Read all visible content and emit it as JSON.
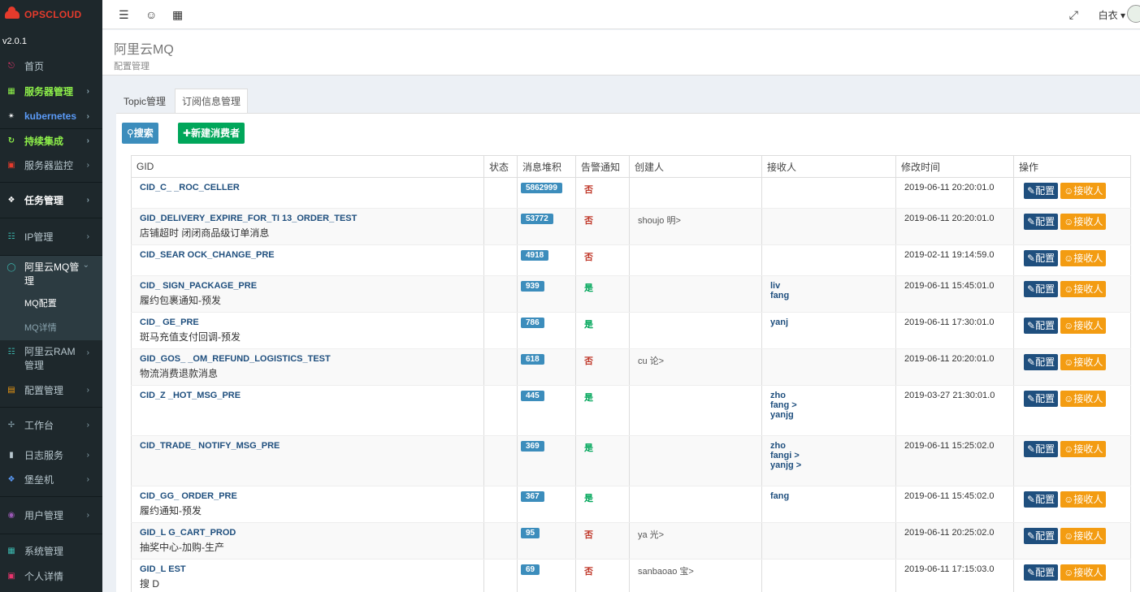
{
  "sidebar": {
    "logo": "OPSCLOUD",
    "version": "v2.0.1",
    "items": [
      {
        "label": "首页",
        "icon": "dashboard-icon"
      },
      {
        "label": "服务器管理",
        "icon": "windows-icon"
      },
      {
        "label": "kubernetes",
        "icon": "kubernetes-icon"
      },
      {
        "label": "持续集成",
        "icon": "ci-icon"
      },
      {
        "label": "服务器监控",
        "icon": "monitor-icon"
      },
      {
        "label": "任务管理",
        "icon": "task-icon"
      },
      {
        "label": "IP管理",
        "icon": "network-icon"
      },
      {
        "label": "阿里云MQ管理",
        "icon": "chat-icon"
      },
      {
        "label": "阿里云RAM管理",
        "icon": "ram-icon"
      },
      {
        "label": "配置管理",
        "icon": "config-icon"
      },
      {
        "label": "工作台",
        "icon": "workbench-icon"
      },
      {
        "label": "日志服务",
        "icon": "log-icon"
      },
      {
        "label": "堡垒机",
        "icon": "bastion-icon"
      },
      {
        "label": "用户管理",
        "icon": "user-icon"
      },
      {
        "label": "系统管理",
        "icon": "system-icon"
      },
      {
        "label": "个人详情",
        "icon": "profile-icon"
      }
    ],
    "sub": [
      "MQ配置",
      "MQ详情"
    ]
  },
  "topbar": {
    "user": "白衣"
  },
  "header": {
    "title": "阿里云MQ",
    "subtitle": "配置管理"
  },
  "tabs": [
    "Topic管理",
    "订阅信息管理"
  ],
  "buttons": {
    "search": "搜索",
    "new": "新建消费者"
  },
  "table": {
    "headers": [
      "GID",
      "状态",
      "消息堆积",
      "告警通知",
      "创建人",
      "接收人",
      "修改时间",
      "操作"
    ],
    "config_label": "配置",
    "recv_label": "接收人",
    "rows": [
      {
        "gid": "CID_C_ _ROC_CELLER",
        "desc": "",
        "stock": "5862999",
        "alarm": "否",
        "creator": "",
        "receivers": [],
        "time": "2019-06-11 20:20:01.0"
      },
      {
        "gid": "GID_DELIVERY_EXPIRE_FOR_TI 13_ORDER_TEST",
        "desc": "店铺超时 闭闭商品级订单消息",
        "stock": "53772",
        "alarm": "否",
        "creator": "shoujo 明>",
        "receivers": [],
        "time": "2019-06-11 20:20:01.0"
      },
      {
        "gid": "CID_SEAR OCK_CHANGE_PRE",
        "desc": "",
        "stock": "4918",
        "alarm": "否",
        "creator": "",
        "receivers": [],
        "time": "2019-02-11 19:14:59.0"
      },
      {
        "gid": "CID_ SIGN_PACKAGE_PRE",
        "desc": "履约包裹通知-预发",
        "stock": "939",
        "alarm": "是",
        "creator": "",
        "receivers": [
          "liv",
          "fang"
        ],
        "time": "2019-06-11 15:45:01.0"
      },
      {
        "gid": "CID_ GE_PRE",
        "desc": "斑马充值支付回调-预发",
        "stock": "786",
        "alarm": "是",
        "creator": "",
        "receivers": [
          "yanj"
        ],
        "time": "2019-06-11 17:30:01.0"
      },
      {
        "gid": "GID_GOS_ _OM_REFUND_LOGISTICS_TEST",
        "desc": "物流消费退款消息",
        "stock": "618",
        "alarm": "否",
        "creator": "cu 论>",
        "receivers": [],
        "time": "2019-06-11 20:20:01.0"
      },
      {
        "gid": "CID_Z _HOT_MSG_PRE",
        "desc": "",
        "stock": "445",
        "alarm": "是",
        "creator": "",
        "receivers": [
          "zho",
          "fang >",
          "yanjg"
        ],
        "time": "2019-03-27 21:30:01.0"
      },
      {
        "gid": "CID_TRADE_ NOTIFY_MSG_PRE",
        "desc": "",
        "stock": "369",
        "alarm": "是",
        "creator": "",
        "receivers": [
          "zho",
          "fangi >",
          "yanjg >"
        ],
        "time": "2019-06-11 15:25:02.0"
      },
      {
        "gid": "CID_GG_ ORDER_PRE",
        "desc": "履约通知-预发",
        "stock": "367",
        "alarm": "是",
        "creator": "",
        "receivers": [
          "fang"
        ],
        "time": "2019-06-11 15:45:02.0"
      },
      {
        "gid": "GID_L G_CART_PROD",
        "desc": "抽奖中心-加购-生产",
        "stock": "95",
        "alarm": "否",
        "creator": "ya 光>",
        "receivers": [],
        "time": "2019-06-11 20:25:02.0"
      },
      {
        "gid": "GID_L EST",
        "desc": "搜 D",
        "stock": "69",
        "alarm": "否",
        "creator": "sanbaoao 宝>",
        "receivers": [],
        "time": "2019-06-11 17:15:03.0"
      }
    ]
  },
  "colors": {
    "accent": "#3c8dbc",
    "success": "#00a65a",
    "warning": "#f39c12",
    "sidebar": "#1e282c"
  }
}
